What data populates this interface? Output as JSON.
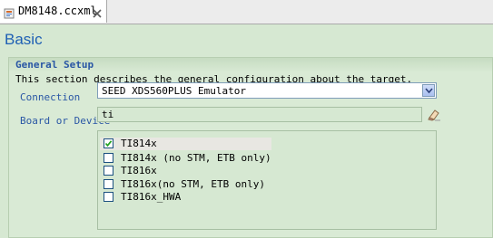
{
  "tab": {
    "label": "DM8148.ccxml"
  },
  "page": {
    "title": "Basic"
  },
  "section": {
    "title": "General Setup",
    "description": "This section describes the general configuration about the target."
  },
  "connection": {
    "label": "Connection",
    "selected": "SEED XDS560PLUS Emulator"
  },
  "board": {
    "label": "Board or Device",
    "filter_value": "ti"
  },
  "devices": [
    {
      "label": "TI814x",
      "checked": true
    },
    {
      "label": "TI814x (no STM, ETB only)",
      "checked": false
    },
    {
      "label": "TI816x",
      "checked": false
    },
    {
      "label": "TI816x(no STM, ETB only)",
      "checked": false
    },
    {
      "label": "TI816x_HWA",
      "checked": false
    }
  ],
  "icons": {
    "tab": "xml-file-icon",
    "close": "close-icon",
    "dropdown": "chevron-down-icon",
    "clear": "eraser-icon",
    "check": "checkmark-icon"
  },
  "colors": {
    "background": "#d6e8d2",
    "title": "#1e5fb4",
    "label": "#2a57a5",
    "check": "#21a121"
  }
}
